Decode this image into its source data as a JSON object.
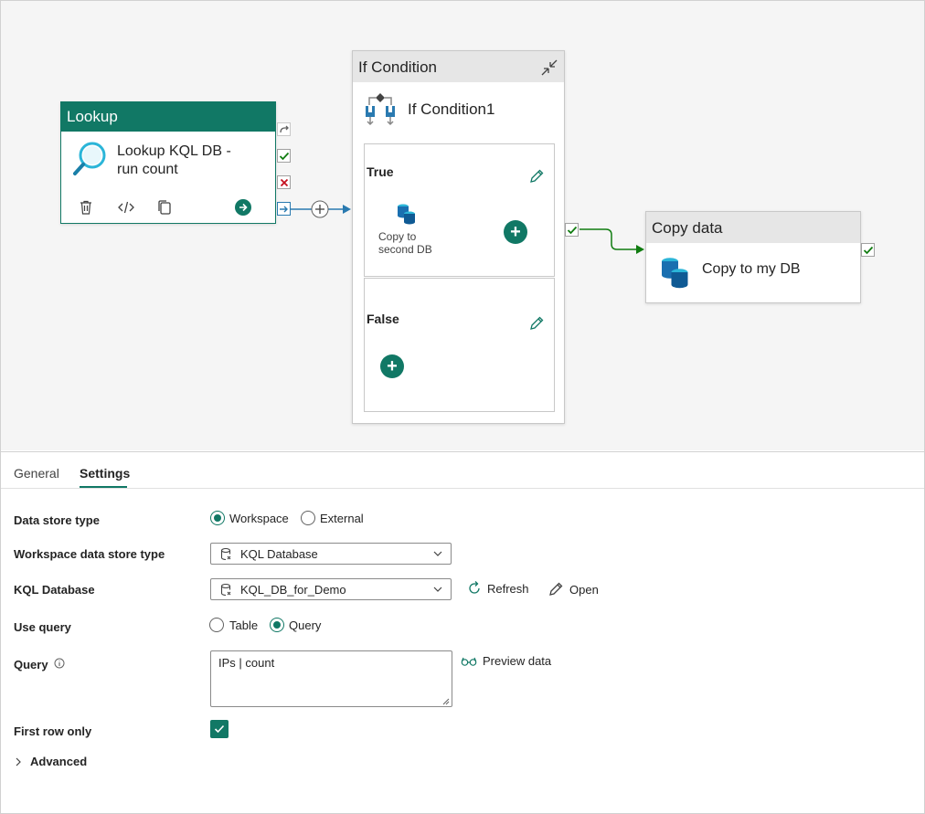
{
  "lookup": {
    "header": "Lookup",
    "title": "Lookup KQL DB - run count",
    "tools": [
      "delete-icon",
      "code-icon",
      "copy-icon",
      "go-icon"
    ]
  },
  "if_condition": {
    "header": "If Condition",
    "name": "If Condition1",
    "true_branch": {
      "label": "True",
      "activity_label": "Copy to second DB"
    },
    "false_branch": {
      "label": "False"
    }
  },
  "copy_data": {
    "header": "Copy data",
    "title": "Copy to my DB"
  },
  "tabs": [
    {
      "label": "General",
      "active": false
    },
    {
      "label": "Settings",
      "active": true
    }
  ],
  "settings": {
    "data_store_type": {
      "label": "Data store type",
      "options": [
        "Workspace",
        "External"
      ],
      "selected": "Workspace"
    },
    "workspace_data_store_type": {
      "label": "Workspace data store type",
      "value": "KQL Database"
    },
    "kql_database": {
      "label": "KQL Database",
      "value": "KQL_DB_for_Demo",
      "refresh_label": "Refresh",
      "open_label": "Open"
    },
    "use_query": {
      "label": "Use query",
      "options": [
        "Table",
        "Query"
      ],
      "selected": "Query"
    },
    "query": {
      "label": "Query",
      "value": "IPs | count",
      "preview_label": "Preview data"
    },
    "first_row_only": {
      "label": "First row only",
      "checked": true
    },
    "advanced": {
      "label": "Advanced"
    }
  },
  "colors": {
    "accent": "#117865",
    "success": "#107c10",
    "fail": "#c50f1f",
    "connector": "#2a7ab0"
  }
}
